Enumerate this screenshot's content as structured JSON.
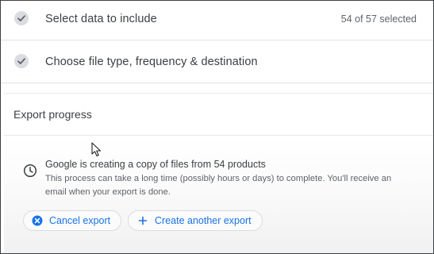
{
  "steps": [
    {
      "label": "Select data to include",
      "meta": "54 of 57 selected",
      "icon": "check-icon",
      "status": "complete"
    },
    {
      "label": "Choose file type, frequency & destination",
      "icon": "check-icon",
      "status": "complete"
    }
  ],
  "export": {
    "title": "Export progress",
    "message_title": "Google is creating a copy of files from 54 products",
    "message_body": "This process can take a long time (possibly hours or days) to complete. You'll receive an email when your export is done.",
    "status_icon": "clock-icon",
    "buttons": {
      "cancel": {
        "label": "Cancel export",
        "icon": "cancel-circle-icon"
      },
      "create": {
        "label": "Create another export",
        "icon": "plus-icon"
      }
    }
  },
  "colors": {
    "accent": "#1a73e8",
    "check_bg": "#dadce0",
    "text": "#3c4043",
    "muted": "#5f6368"
  }
}
